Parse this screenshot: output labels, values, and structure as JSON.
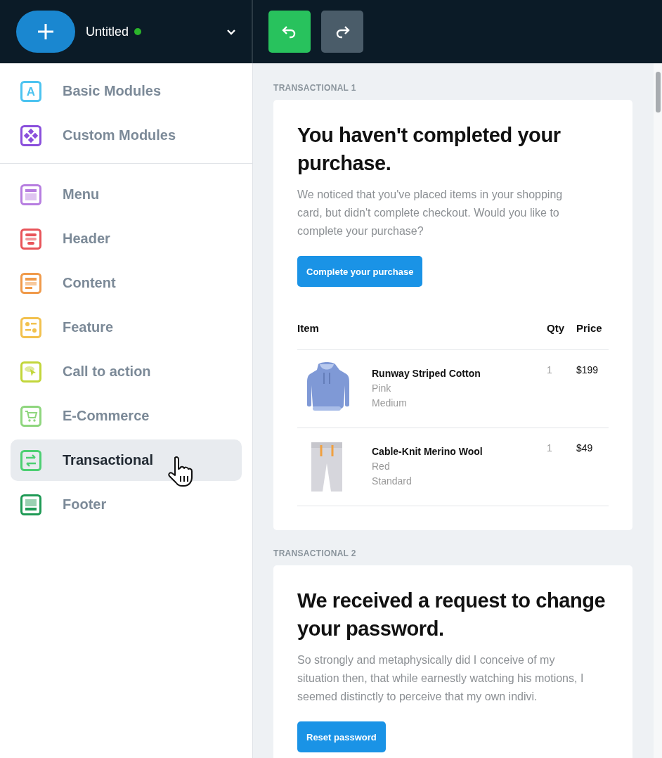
{
  "header": {
    "document_title": "Untitled",
    "saved": true
  },
  "sidebar": {
    "groups": [
      [
        {
          "label": "Basic Modules",
          "kind": "letter",
          "icon_text": "A",
          "color": "#4cc3f0",
          "selected": false
        },
        {
          "label": "Custom Modules",
          "kind": "diamonds",
          "color": "#8a4fdc",
          "selected": false
        }
      ],
      [
        {
          "label": "Menu",
          "kind": "menu",
          "color": "#b77ee0",
          "selected": false
        },
        {
          "label": "Header",
          "kind": "header",
          "color": "#e8545a",
          "selected": false
        },
        {
          "label": "Content",
          "kind": "content",
          "color": "#f09a4a",
          "selected": false
        },
        {
          "label": "Feature",
          "kind": "feature",
          "color": "#f2c14e",
          "selected": false
        },
        {
          "label": "Call to action",
          "kind": "cta",
          "color": "#c2d63a",
          "selected": false
        },
        {
          "label": "E-Commerce",
          "kind": "cart",
          "color": "#8fd67e",
          "selected": false
        },
        {
          "label": "Transactional",
          "kind": "transfer",
          "color": "#4ccf72",
          "selected": true
        },
        {
          "label": "Footer",
          "kind": "footer",
          "color": "#1f9a55",
          "selected": false
        }
      ]
    ]
  },
  "templates": [
    {
      "label": "TRANSACTIONAL 1",
      "title": "You haven't completed your purchase.",
      "body": "We noticed that you've placed items in your shopping card, but didn't complete checkout. Would you like to complete your purchase?",
      "button": "Complete your purchase",
      "table": {
        "columns": [
          "Item",
          "Qty",
          "Price"
        ],
        "rows": [
          {
            "kind": "hoodie",
            "name": "Runway Striped Cotton",
            "color_name": "Pink",
            "size": "Medium",
            "qty": "1",
            "price": "$199"
          },
          {
            "kind": "shorts",
            "name": "Cable-Knit Merino Wool",
            "color_name": "Red",
            "size": "Standard",
            "qty": "1",
            "price": "$49"
          }
        ]
      }
    },
    {
      "label": "TRANSACTIONAL 2",
      "title": "We received a request to change your password.",
      "body": "So strongly and metaphysically did I conceive of my situation then, that while earnestly watching his motions, I seemed distinctly to perceive that my own indivi.",
      "button": "Reset password"
    }
  ]
}
